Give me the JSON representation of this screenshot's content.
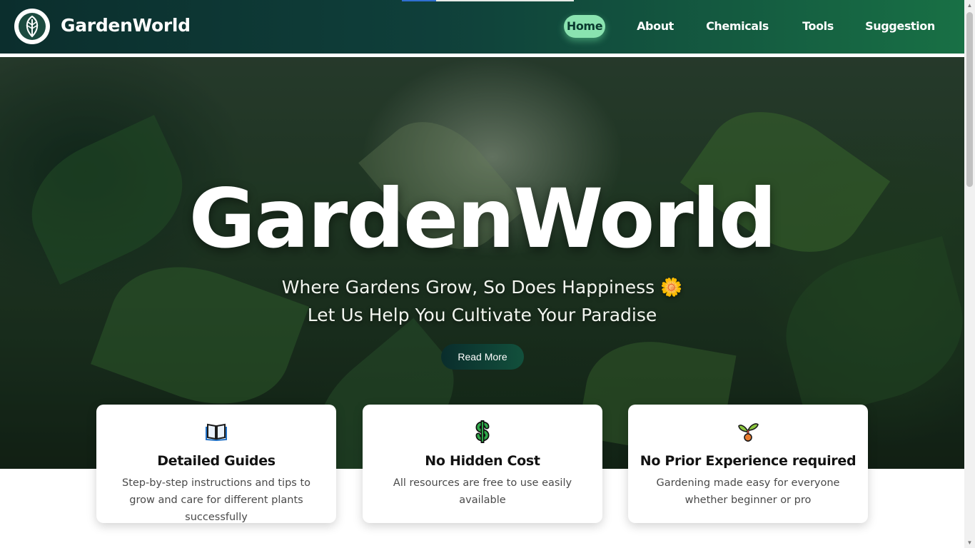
{
  "header": {
    "brand": "GardenWorld",
    "nav": [
      "Home",
      "About",
      "Chemicals",
      "Tools",
      "Suggestion"
    ],
    "active_nav": "Home"
  },
  "hero": {
    "title": "GardenWorld",
    "subtitle_line1": "Where Gardens Grow, So Does Happiness 🌼",
    "subtitle_line2": "Let Us Help You Cultivate Your Paradise",
    "button": "Read More"
  },
  "features": [
    {
      "icon": "open-book-icon",
      "title": "Detailed Guides",
      "desc": "Step-by-step instructions and tips to grow and care for different plants successfully"
    },
    {
      "icon": "dollar-sign-icon",
      "title": "No Hidden Cost",
      "desc": "All resources are free to use easily available"
    },
    {
      "icon": "sprout-icon",
      "title": "No Prior Experience required",
      "desc": "Gardening made easy for everyone whether beginner or pro"
    }
  ],
  "colors": {
    "header_start": "#0b2e2d",
    "header_end": "#187045",
    "active_nav": "#8ae3b0",
    "button": "#0a2d2c"
  }
}
